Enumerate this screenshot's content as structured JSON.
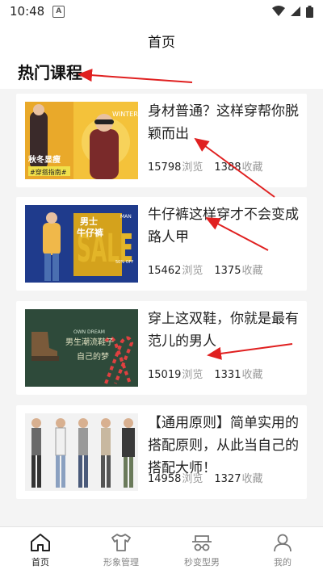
{
  "status": {
    "time": "10:48",
    "badge": "A"
  },
  "header": {
    "title": "首页"
  },
  "section": {
    "title": "热门课程"
  },
  "courses": [
    {
      "title": "身材普通？这样穿帮你脱颖而出",
      "views": "15798",
      "views_label": "浏览",
      "favs": "1388",
      "favs_label": "收藏",
      "img_text": {
        "top": "WINTER",
        "main": "秋冬显瘦",
        "sub": "#穿搭指南#"
      }
    },
    {
      "title": "牛仔裤这样穿才不会变成路人甲",
      "views": "15462",
      "views_label": "浏览",
      "favs": "1375",
      "favs_label": "收藏",
      "img_text": {
        "main": "男士",
        "main2": "牛仔裤",
        "tag": "MAN",
        "big": "SALE",
        "off": "50% OFF"
      }
    },
    {
      "title": "穿上这双鞋，你就是最有范儿的男人",
      "views": "15019",
      "views_label": "浏览",
      "favs": "1331",
      "favs_label": "收藏",
      "img_text": {
        "top": "OWN DREAM",
        "main": "男生潮流鞋子",
        "sub": "自己的梦"
      }
    },
    {
      "title": "【通用原则】简单实用的搭配原则，从此当自己的搭配大师！",
      "views": "14958",
      "views_label": "浏览",
      "favs": "1327",
      "favs_label": "收藏",
      "img_text": {}
    }
  ],
  "tabs": [
    {
      "label": "首页",
      "icon": "home-icon",
      "active": true
    },
    {
      "label": "形象管理",
      "icon": "tshirt-icon",
      "active": false
    },
    {
      "label": "秒变型男",
      "icon": "hat-glasses-icon",
      "active": false
    },
    {
      "label": "我的",
      "icon": "user-icon",
      "active": false
    }
  ],
  "colors": {
    "accent": "#e02020",
    "muted": "#999999",
    "card_bg": "#ffffff",
    "page_bg": "#f4f4f4"
  }
}
